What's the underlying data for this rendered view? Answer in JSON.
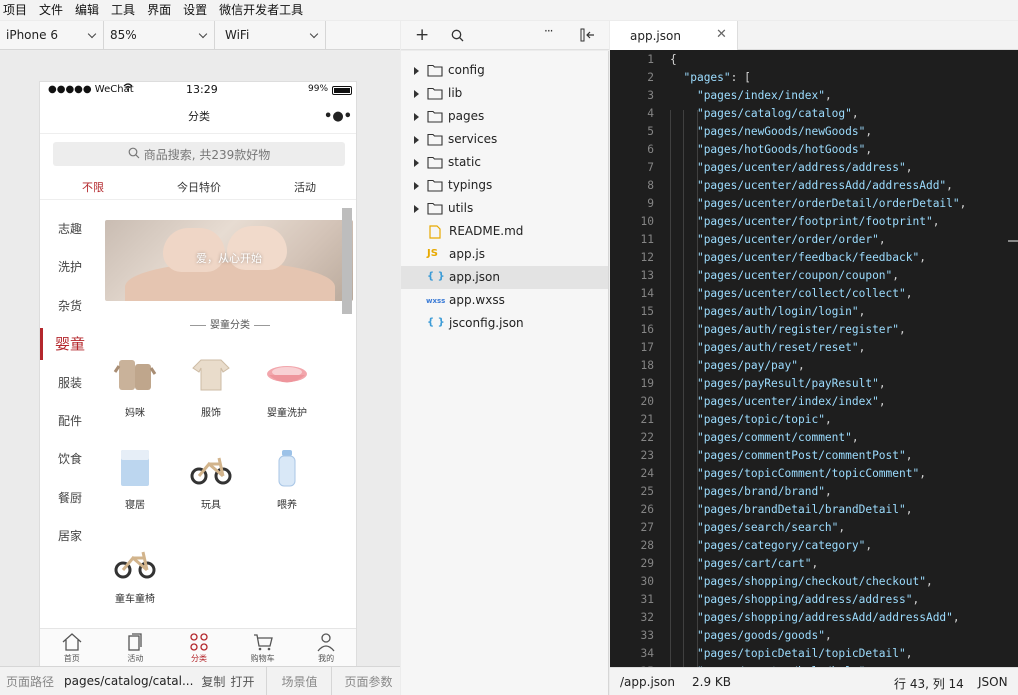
{
  "menu": [
    "项目",
    "文件",
    "编辑",
    "工具",
    "界面",
    "设置",
    "微信开发者工具"
  ],
  "simulator": {
    "device": "iPhone 6",
    "zoom": "85%",
    "network": "WiFi",
    "phone": {
      "carrier": "●●●●● WeChat",
      "time": "13:29",
      "battery": "99%",
      "title": "分类",
      "more": "•●•",
      "search_placeholder": "商品搜索, 共239款好物",
      "filters": [
        "不限",
        "今日特价",
        "活动"
      ],
      "categories": [
        "志趣",
        "洗护",
        "杂货",
        "婴童",
        "服装",
        "配件",
        "饮食",
        "餐厨",
        "居家"
      ],
      "active_category": 3,
      "banner_text": "爱，从心开始",
      "sub_title": "婴童分类",
      "products": [
        "妈咪",
        "服饰",
        "婴童洗护",
        "寝居",
        "玩具",
        "喂养",
        "童车童椅"
      ],
      "tabs": [
        "首页",
        "活动",
        "分类",
        "购物车",
        "我的"
      ],
      "active_tab": 2
    },
    "status": {
      "path_label": "页面路径",
      "path_value": "pages/catalog/catal...",
      "copy": "复制",
      "open": "打开",
      "scene": "场景值",
      "params": "页面参数"
    }
  },
  "tree": {
    "items": [
      {
        "name": "config",
        "type": "folder"
      },
      {
        "name": "lib",
        "type": "folder"
      },
      {
        "name": "pages",
        "type": "folder"
      },
      {
        "name": "services",
        "type": "folder"
      },
      {
        "name": "static",
        "type": "folder"
      },
      {
        "name": "typings",
        "type": "folder"
      },
      {
        "name": "utils",
        "type": "folder"
      },
      {
        "name": "README.md",
        "type": "md"
      },
      {
        "name": "app.js",
        "type": "js"
      },
      {
        "name": "app.json",
        "type": "json"
      },
      {
        "name": "app.wxss",
        "type": "wxss"
      },
      {
        "name": "jsconfig.json",
        "type": "json"
      }
    ],
    "selected": "app.json",
    "js_badge": "JS",
    "wxss_badge": "wxss",
    "json_badge": "{ }"
  },
  "editor": {
    "tab": "app.json",
    "lines": [
      "{",
      "  \"pages\": [",
      "    \"pages/index/index\",",
      "    \"pages/catalog/catalog\",",
      "    \"pages/newGoods/newGoods\",",
      "    \"pages/hotGoods/hotGoods\",",
      "    \"pages/ucenter/address/address\",",
      "    \"pages/ucenter/addressAdd/addressAdd\",",
      "    \"pages/ucenter/orderDetail/orderDetail\",",
      "    \"pages/ucenter/footprint/footprint\",",
      "    \"pages/ucenter/order/order\",",
      "    \"pages/ucenter/feedback/feedback\",",
      "    \"pages/ucenter/coupon/coupon\",",
      "    \"pages/ucenter/collect/collect\",",
      "    \"pages/auth/login/login\",",
      "    \"pages/auth/register/register\",",
      "    \"pages/auth/reset/reset\",",
      "    \"pages/pay/pay\",",
      "    \"pages/payResult/payResult\",",
      "    \"pages/ucenter/index/index\",",
      "    \"pages/topic/topic\",",
      "    \"pages/comment/comment\",",
      "    \"pages/commentPost/commentPost\",",
      "    \"pages/topicComment/topicComment\",",
      "    \"pages/brand/brand\",",
      "    \"pages/brandDetail/brandDetail\",",
      "    \"pages/search/search\",",
      "    \"pages/category/category\",",
      "    \"pages/cart/cart\",",
      "    \"pages/shopping/checkout/checkout\",",
      "    \"pages/shopping/address/address\",",
      "    \"pages/shopping/addressAdd/addressAdd\",",
      "    \"pages/goods/goods\",",
      "    \"pages/topicDetail/topicDetail\",",
      "    \"pages/ucenter/help/help\","
    ],
    "status": {
      "file": "/app.json",
      "size": "2.9 KB",
      "cursor": "行 43, 列 14",
      "lang": "JSON"
    }
  }
}
